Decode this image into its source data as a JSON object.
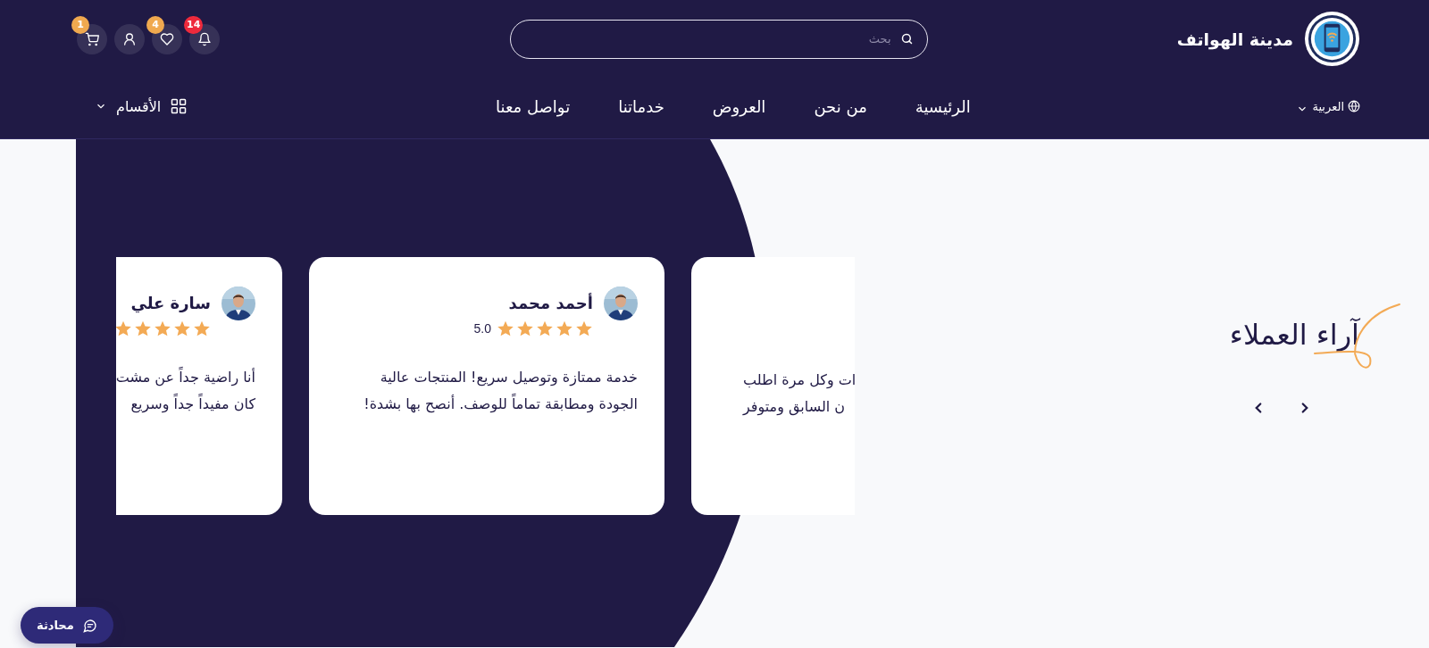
{
  "brand": {
    "name": "مدينة الهواتف"
  },
  "search": {
    "placeholder": "بحث"
  },
  "header_icons": [
    {
      "kind": "bell",
      "badge": "14",
      "color": "#ee2a3c"
    },
    {
      "kind": "heart",
      "badge": "4",
      "color": "#f0a94f"
    },
    {
      "kind": "user"
    },
    {
      "kind": "cart",
      "badge": "1",
      "color": "#f0a94f"
    }
  ],
  "language": "العربية",
  "nav": [
    {
      "label": "الرئيسية"
    },
    {
      "label": "من نحن"
    },
    {
      "label": "العروض"
    },
    {
      "label": "خدماتنا"
    },
    {
      "label": "تواصل معنا"
    }
  ],
  "categories": "الأقسام",
  "section_title": "آراء العملاء",
  "reviews": [
    {
      "kind": "cut_right",
      "lines": [
        "ات وكل مرة اطلب",
        "ن السابق ومتوفر"
      ]
    },
    {
      "kind": "full",
      "name": "أحمد محمد",
      "stars": 5,
      "rating": "5.0",
      "lines": [
        "خدمة ممتازة وتوصيل سريع! المنتجات عالية",
        "الجودة ومطابقة تماماً للوصف. أنصح بها بشدة!"
      ]
    },
    {
      "kind": "cut_left",
      "name": "سارة علي",
      "stars": 5,
      "lines": [
        "أنا راضية جداً عن مشت",
        "كان مفيداً جداً وسريع"
      ]
    }
  ],
  "chat_button": "محادثة"
}
